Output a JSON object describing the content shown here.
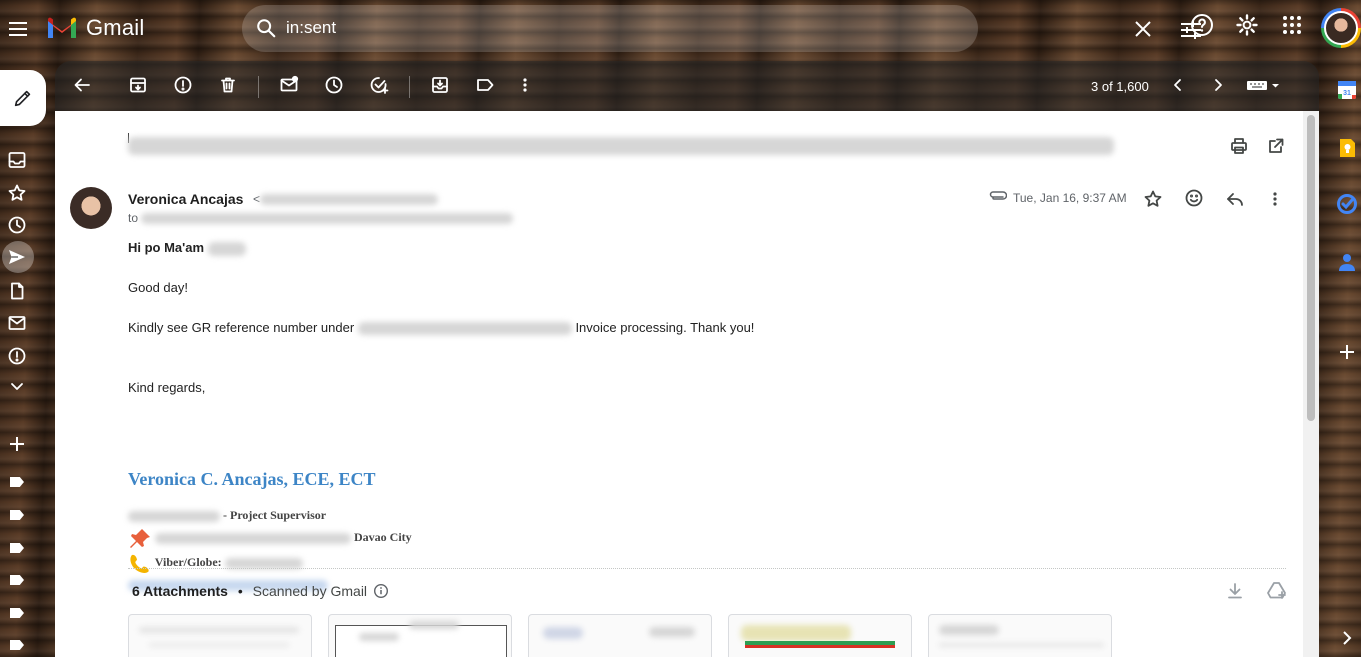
{
  "app": {
    "name": "Gmail"
  },
  "search": {
    "value": "in:sent"
  },
  "toolbar": {
    "counter": "3 of 1,600"
  },
  "message": {
    "sender_name": "Veronica Ancajas",
    "sender_email_open": "<",
    "to_label": "to",
    "date": "Tue, Jan 16, 9:37 AM",
    "greeting": "Hi po Ma'am",
    "line_1": "Good day!",
    "line_2_start": "Kindly see GR reference number under",
    "line_2_end": "Invoice processing. Thank you!",
    "closing": "Kind regards,"
  },
  "signature": {
    "name": "Veronica C. Ancajas, ECE, ECT",
    "title_suffix": "- Project Supervisor",
    "address_suffix": "Davao City",
    "phone_label": "Viber/Globe:"
  },
  "attachments": {
    "count_label": "6 Attachments",
    "separator": "•",
    "scanned_label": "Scanned by Gmail"
  },
  "colors": {
    "signature_blue": "#3d85c6",
    "gmail_red": "#ea4335"
  }
}
